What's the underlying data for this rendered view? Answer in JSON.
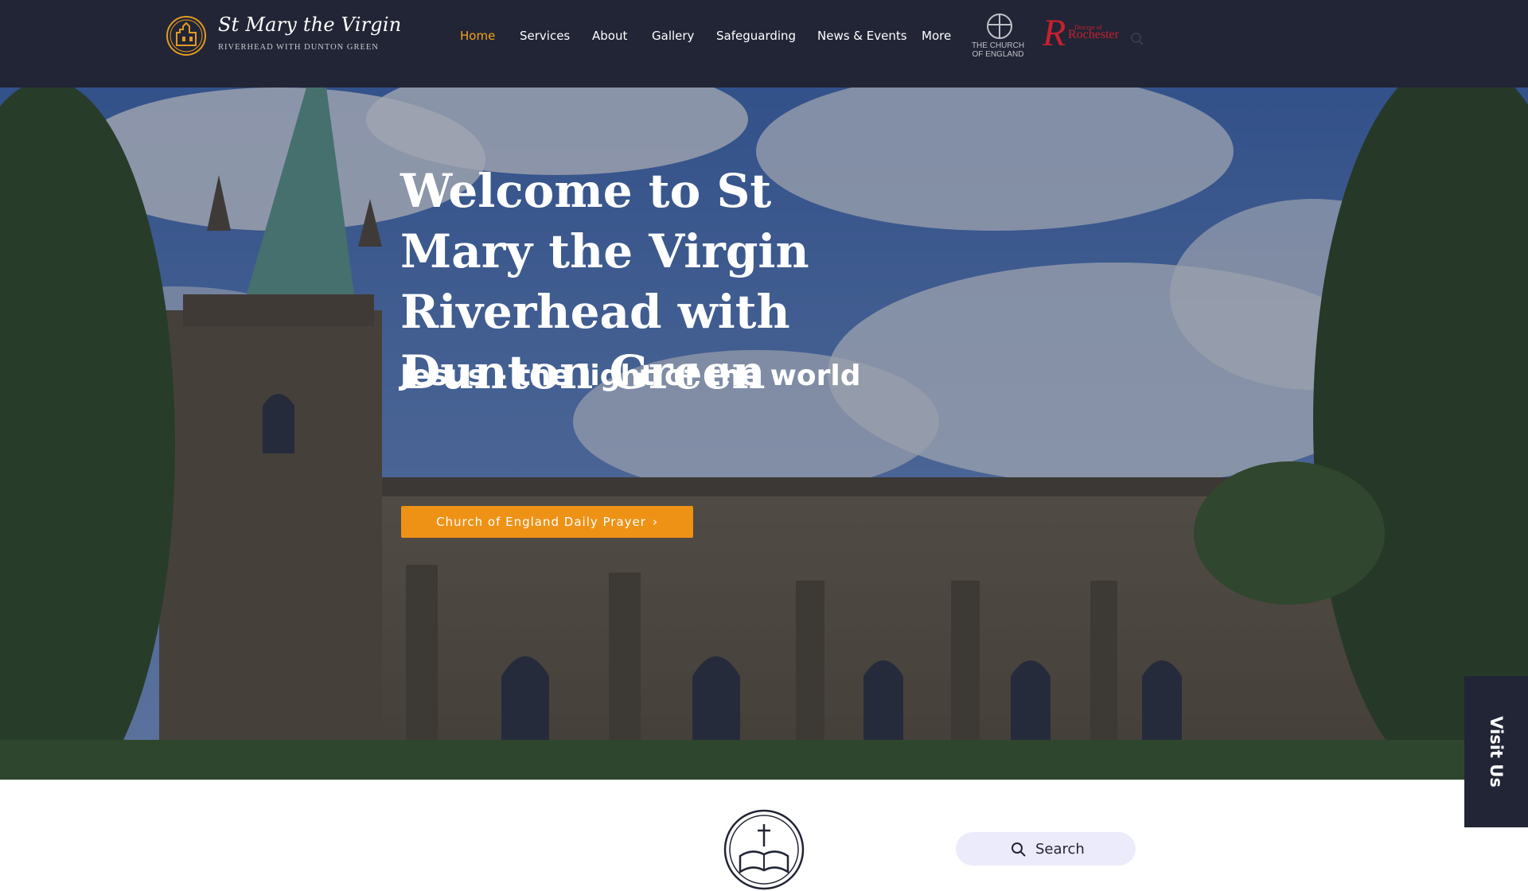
{
  "header": {
    "brand": {
      "title": "St Mary the Virgin",
      "subtitle": "RIVERHEAD WITH DUNTON GREEN"
    },
    "nav": [
      {
        "label": "Home",
        "active": true
      },
      {
        "label": "Services",
        "active": false
      },
      {
        "label": "About",
        "active": false
      },
      {
        "label": "Gallery",
        "active": false
      },
      {
        "label": "Safeguarding",
        "active": false
      },
      {
        "label": "News & Events",
        "active": false
      },
      {
        "label": "More",
        "active": false
      }
    ],
    "coe_logo": {
      "line1": "THE CHURCH",
      "line2": "OF ENGLAND",
      "icon": "cross-in-circle-icon"
    },
    "rochester_logo": {
      "small": "Diocese of",
      "big": "Rochester",
      "initial": "R"
    },
    "search_icon": "search-icon"
  },
  "hero": {
    "title": "Welcome to St Mary the Virgin Riverhead with Dunton Green",
    "subtitle": "Jesus - the light of the world",
    "cta_label": "Church of England Daily Prayer",
    "cta_icon": "chevron-right-icon"
  },
  "visit_us": {
    "label": "Visit Us"
  },
  "search": {
    "label": "Search",
    "icon": "search-icon"
  },
  "colors": {
    "header_bg": "#222535",
    "accent": "#ee9216",
    "nav_active": "#f5a31a",
    "rochester_red": "#c8202f",
    "search_bg": "#ecebfb"
  }
}
